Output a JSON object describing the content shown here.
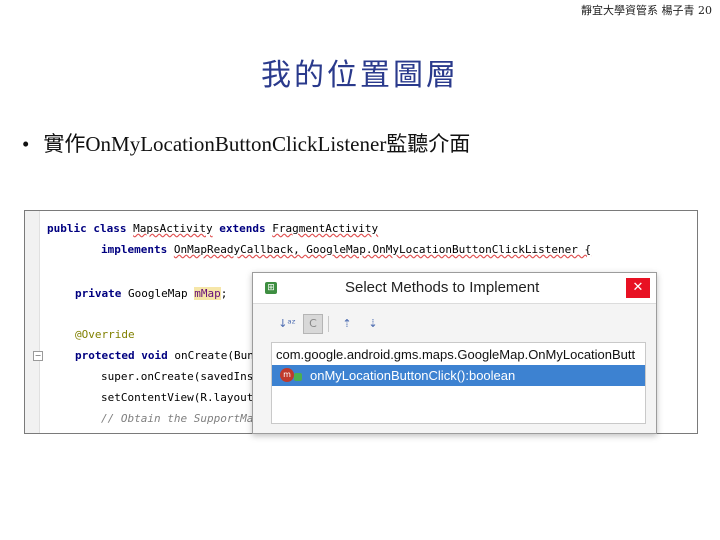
{
  "header": {
    "note": "靜宜大學資管系 楊子青 20"
  },
  "slide": {
    "title": "我的位置圖層",
    "bullet_symbol": "•",
    "bullet_text": "實作OnMyLocationButtonClickListener監聽介面"
  },
  "code": {
    "l1_kw1": "public",
    "l1_kw2": "class",
    "l1_name": "MapsActivity",
    "l1_kw3": "extends",
    "l1_super": "FragmentActivity",
    "l2_kw": "implements",
    "l2_rest": "OnMapReadyCallback, GoogleMap.OnMyLocationButtonClickListener {",
    "l3_kw": "private",
    "l3_type": "GoogleMap",
    "l3_field": "mMap",
    "l3_end": ";",
    "l4_anno": "@Override",
    "l5_kw1": "protected",
    "l5_kw2": "void",
    "l5_rest": "onCreate(Bun",
    "l6": "super.onCreate(savedIns",
    "l7": "setContentView(R.layout",
    "l8_comment": "// Obtain the SupportMapFra"
  },
  "dialog": {
    "title": "Select Methods to Implement",
    "close_glyph": "✕",
    "app_glyph": "⊞",
    "toolbar": {
      "sort_glyph": "↓ᵃᶻ",
      "group_glyph": "C",
      "expand_glyph": "⇡",
      "collapse_glyph": "⇣"
    },
    "group_label": "com.google.android.gms.maps.GoogleMap.OnMyLocationButt",
    "item_icon_glyph": "m",
    "item_label": "onMyLocationButtonClick():boolean"
  }
}
